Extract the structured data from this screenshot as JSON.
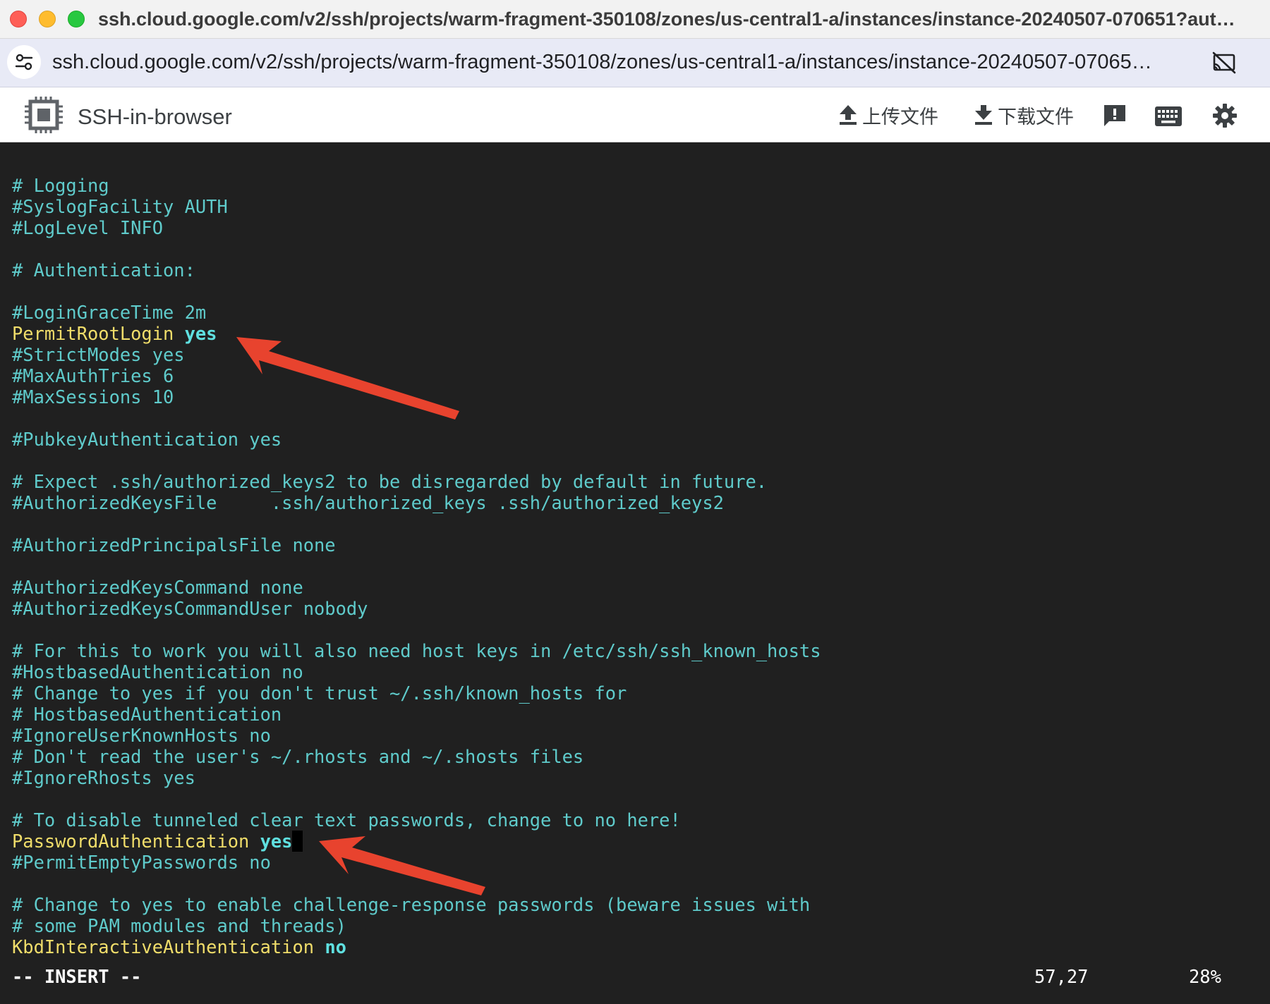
{
  "window": {
    "title": "ssh.cloud.google.com/v2/ssh/projects/warm-fragment-350108/zones/us-central1-a/instances/instance-20240507-070651?aut…"
  },
  "addressbar": {
    "url": "ssh.cloud.google.com/v2/ssh/projects/warm-fragment-350108/zones/us-central1-a/instances/instance-20240507-07065…",
    "site_icon": "tune-icon",
    "cast_icon": "cast-disabled-icon"
  },
  "app": {
    "title": "SSH-in-browser",
    "upload_label": "上传文件",
    "download_label": "下载文件",
    "icons": [
      "chip-icon",
      "upload-icon",
      "download-icon",
      "feedback-icon",
      "keyboard-icon",
      "settings-icon"
    ]
  },
  "terminal": {
    "lines": [
      {
        "text": "# Logging"
      },
      {
        "text": "#SyslogFacility AUTH"
      },
      {
        "text": "#LogLevel INFO"
      },
      {
        "text": ""
      },
      {
        "text": "# Authentication:"
      },
      {
        "text": ""
      },
      {
        "text": "#LoginGraceTime 2m"
      },
      {
        "key": "PermitRootLogin",
        "value": "yes"
      },
      {
        "text": "#StrictModes yes"
      },
      {
        "text": "#MaxAuthTries 6"
      },
      {
        "text": "#MaxSessions 10"
      },
      {
        "text": ""
      },
      {
        "text": "#PubkeyAuthentication yes"
      },
      {
        "text": ""
      },
      {
        "text": "# Expect .ssh/authorized_keys2 to be disregarded by default in future."
      },
      {
        "text": "#AuthorizedKeysFile     .ssh/authorized_keys .ssh/authorized_keys2"
      },
      {
        "text": ""
      },
      {
        "text": "#AuthorizedPrincipalsFile none"
      },
      {
        "text": ""
      },
      {
        "text": "#AuthorizedKeysCommand none"
      },
      {
        "text": "#AuthorizedKeysCommandUser nobody"
      },
      {
        "text": ""
      },
      {
        "text": "# For this to work you will also need host keys in /etc/ssh/ssh_known_hosts"
      },
      {
        "text": "#HostbasedAuthentication no"
      },
      {
        "text": "# Change to yes if you don't trust ~/.ssh/known_hosts for"
      },
      {
        "text": "# HostbasedAuthentication"
      },
      {
        "text": "#IgnoreUserKnownHosts no"
      },
      {
        "text": "# Don't read the user's ~/.rhosts and ~/.shosts files"
      },
      {
        "text": "#IgnoreRhosts yes"
      },
      {
        "text": ""
      },
      {
        "text": "# To disable tunneled clear text passwords, change to no here!"
      },
      {
        "key": "PasswordAuthentication",
        "value": "yes",
        "cursor": true
      },
      {
        "text": "#PermitEmptyPasswords no"
      },
      {
        "text": ""
      },
      {
        "text": "# Change to yes to enable challenge-response passwords (beware issues with"
      },
      {
        "text": "# some PAM modules and threads)"
      },
      {
        "key": "KbdInteractiveAuthentication",
        "value": "no"
      }
    ],
    "status": {
      "mode": "-- INSERT --",
      "position": "57,27",
      "percent": "28%"
    }
  },
  "colors": {
    "terminal_bg": "#202020",
    "comment": "#5fcbcb",
    "keyword": "#f0dd6a",
    "value": "#5fe0e0",
    "annotation_arrow": "#e8432e"
  },
  "annotations": [
    "red-arrow",
    "red-arrow"
  ]
}
